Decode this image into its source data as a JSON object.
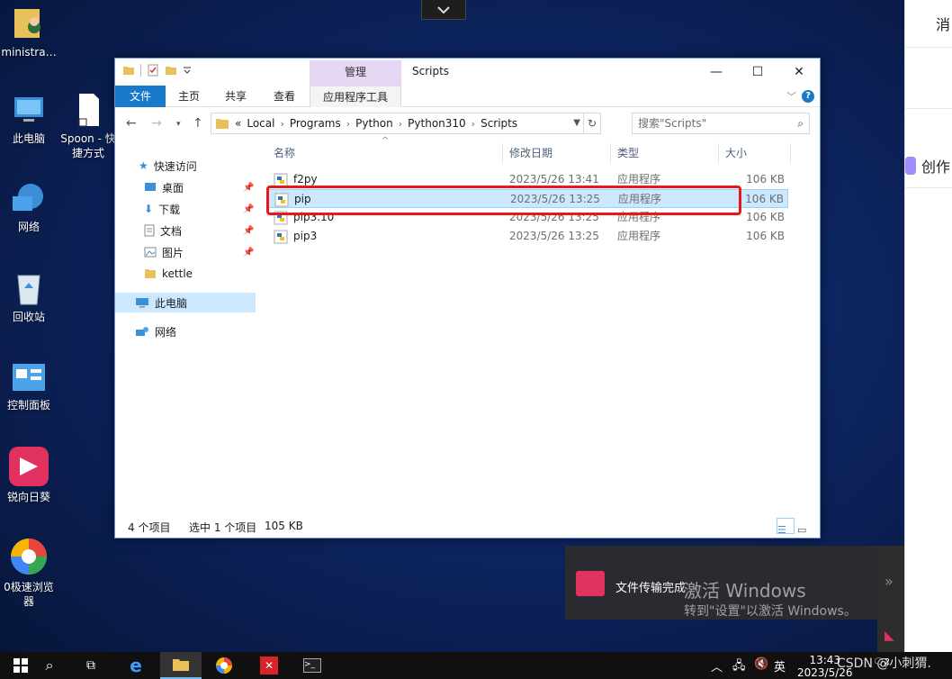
{
  "desktop": {
    "icons": [
      {
        "label": "ministra…"
      },
      {
        "label": "此电脑"
      },
      {
        "label": "Spoon - 快",
        "label2": "捷方式"
      },
      {
        "label": "网络"
      },
      {
        "label": "回收站"
      },
      {
        "label": "控制面板"
      },
      {
        "label": "锐向日葵"
      },
      {
        "label": "0极速浏览",
        "label2": "器"
      }
    ]
  },
  "right_panel": {
    "top_text": "消",
    "create_text": "创作"
  },
  "explorer": {
    "title": "Scripts",
    "manage_tab": "管理",
    "ribbon_tabs": [
      "文件",
      "主页",
      "共享",
      "查看"
    ],
    "app_tools_tab": "应用程序工具",
    "help_label": "?",
    "breadcrumb": [
      "«",
      "Local",
      "Programs",
      "Python",
      "Python310",
      "Scripts"
    ],
    "search_placeholder": "搜索\"Scripts\"",
    "nav": {
      "quick_access": "快速访问",
      "items": [
        "桌面",
        "下载",
        "文档",
        "图片",
        "kettle"
      ],
      "this_pc": "此电脑",
      "network": "网络"
    },
    "columns": {
      "name": "名称",
      "date": "修改日期",
      "type": "类型",
      "size": "大小"
    },
    "files": [
      {
        "name": "f2py",
        "date": "2023/5/26 13:41",
        "type": "应用程序",
        "size": "106 KB"
      },
      {
        "name": "pip",
        "date": "2023/5/26 13:25",
        "type": "应用程序",
        "size": "106 KB"
      },
      {
        "name": "pip3.10",
        "date": "2023/5/26 13:25",
        "type": "应用程序",
        "size": "106 KB"
      },
      {
        "name": "pip3",
        "date": "2023/5/26 13:25",
        "type": "应用程序",
        "size": "106 KB"
      }
    ],
    "status": {
      "count": "4 个项目",
      "selected": "选中 1 个项目",
      "size": "105 KB"
    }
  },
  "toast": {
    "text": "文件传输完成"
  },
  "activation": {
    "line1": "激活 Windows",
    "line2": "转到\"设置\"以激活 Windows。"
  },
  "watermark": "CSDN @小刺猬.",
  "taskbar": {
    "ime": "英",
    "time": "13:43",
    "date": "2023/5/26",
    "badge": "2"
  },
  "colors": {
    "accent": "#1979ca",
    "selection": "#cce8ff",
    "highlight_box": "#e81818"
  }
}
